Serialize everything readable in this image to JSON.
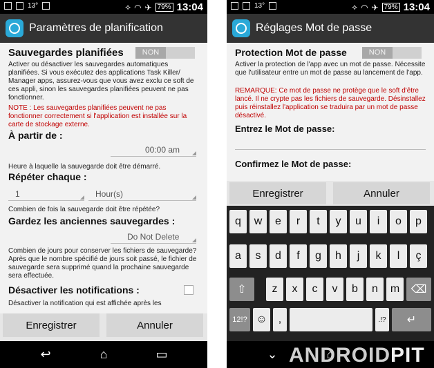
{
  "left": {
    "status": {
      "temp": "13°",
      "battery": "79%",
      "time": "13:04"
    },
    "title": "Paramètres de planification",
    "scheduled": {
      "label": "Sauvegardes planifiées",
      "toggle": "NON",
      "desc": "Activer ou désactiver les sauvegardes automatiques planifiées. Si vous exécutez des applications Task Killer/ Manager apps, assurez-vous que vous avez exclu ce soft de ces appli, sinon les sauvegardes planifiées peuvent ne pas fonctionner.",
      "note": "NOTE : Les sauvegardes planifiées peuvent ne pas fonctionner correctement si l'application est installée sur la carte de stockage externe."
    },
    "from": {
      "label": "À partir de :",
      "value": "00:00 am",
      "desc": "Heure à laquelle la sauvegarde doit être démarré."
    },
    "repeat": {
      "label": "Répéter chaque :",
      "count": "1",
      "unit": "Hour(s)",
      "desc": "Combien de fois la sauvegarde doit être répétée?"
    },
    "keep": {
      "label": "Gardez les anciennes sauvegardes :",
      "value": "Do Not Delete",
      "desc": "Combien de jours pour conserver les fichiers de sauvegarde? Après que le nombre spécifié de jours soit passé, le fichier de sauvegarde sera supprimé quand la prochaine sauvegarde sera effectuée."
    },
    "notif": {
      "label": "Désactiver les notifications :",
      "desc": "Désactiver la notification qui est affichée après les"
    },
    "buttons": {
      "save": "Enregistrer",
      "cancel": "Annuler"
    }
  },
  "right": {
    "status": {
      "temp": "13°",
      "battery": "79%",
      "time": "13:04"
    },
    "title": "Réglages Mot de passe",
    "protection": {
      "label": "Protection Mot de passe",
      "toggle": "NON",
      "desc": "Activer la protection de l'app avec un mot de passe. Nécessite que l'utilisateur entre un mot de passe au lancement de l'app.",
      "note": "REMARQUE: Ce mot de passe ne protège que le soft d'être lancé. Il ne crypte pas les fichiers de sauvegarde. Désinstallez puis réinstallez l'application se traduira par un mot de passe désactivé."
    },
    "enter_label": "Entrez le Mot de passe:",
    "confirm_label": "Confirmez le Mot de passe:",
    "buttons": {
      "save": "Enregistrer",
      "cancel": "Annuler"
    },
    "keyboard": {
      "row1": [
        "q",
        "w",
        "e",
        "r",
        "t",
        "y",
        "u",
        "i",
        "o",
        "p"
      ],
      "row2": [
        "a",
        "s",
        "d",
        "f",
        "g",
        "h",
        "j",
        "k",
        "l",
        "ç"
      ],
      "row3": [
        "z",
        "x",
        "c",
        "v",
        "b",
        "n",
        "m"
      ],
      "symbols": "12!?",
      "comma": ",",
      "punct": ".!?"
    }
  },
  "watermark": {
    "brand": "ANDROID",
    "brand2": "PIT"
  }
}
